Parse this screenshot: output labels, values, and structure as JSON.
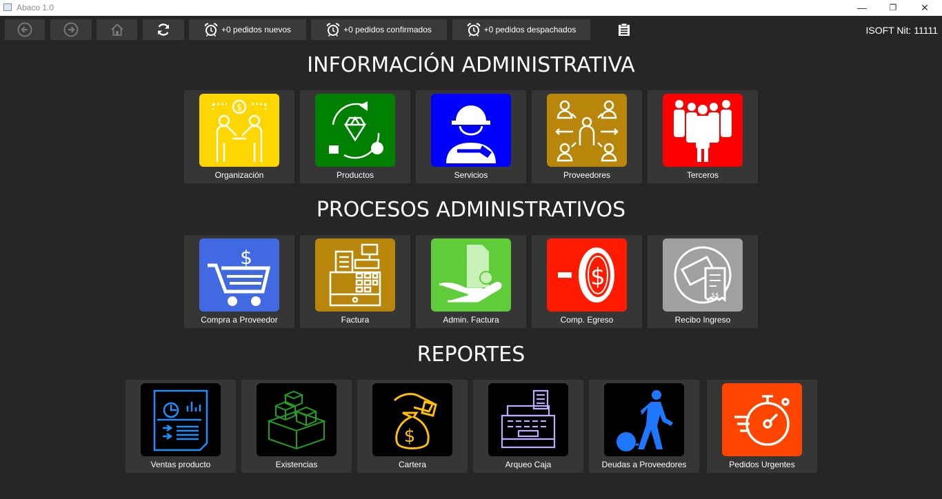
{
  "window": {
    "title": "Abaco 1.0",
    "minimize": "—",
    "restore": "❐",
    "close": "✕"
  },
  "toolbar": {
    "back_icon": "arrow-left-circle-icon",
    "forward_icon": "arrow-right-circle-icon",
    "home_icon": "home-icon",
    "refresh_icon": "refresh-icon",
    "new_orders": "+0 pedidos nuevos",
    "confirmed_orders": "+0 pedidos confirmados",
    "dispatched_orders": "+0 pedidos despachados",
    "clipboard_icon": "clipboard-icon",
    "company": "ISOFT Nit: 11111"
  },
  "sections": {
    "info_title": "INFORMACIÓN ADMINISTRATIVA",
    "process_title": "PROCESOS ADMINISTRATIVOS",
    "reports_title": "REPORTES"
  },
  "info_tiles": [
    {
      "label": "Organización",
      "color": "#ffd700",
      "icon": "handshake-icon"
    },
    {
      "label": "Productos",
      "color": "#008000",
      "icon": "diamond-icon"
    },
    {
      "label": "Servicios",
      "color": "#0000ff",
      "icon": "worker-icon"
    },
    {
      "label": "Proveedores",
      "color": "#b8860b",
      "icon": "network-people-icon"
    },
    {
      "label": "Terceros",
      "color": "#ff0000",
      "icon": "crowd-icon"
    }
  ],
  "process_tiles": [
    {
      "label": "Compra a Proveedor",
      "color": "#4169e1",
      "icon": "shopping-cart-icon"
    },
    {
      "label": "Factura",
      "color": "#b8860b",
      "icon": "cash-register-icon"
    },
    {
      "label": "Admin. Factura",
      "color": "#5fcd3a",
      "icon": "hand-invoice-icon"
    },
    {
      "label": "Comp. Egreso",
      "color": "#ff1a00",
      "icon": "minus-coin-icon"
    },
    {
      "label": "Recibo Ingreso",
      "color": "#a0a0a0",
      "icon": "receipt-icon"
    }
  ],
  "report_tiles": [
    {
      "label": "Ventas producto",
      "color": "#000000",
      "icon": "sales-report-icon"
    },
    {
      "label": "Existencias",
      "color": "#000000",
      "icon": "boxes-icon"
    },
    {
      "label": "Cartera",
      "color": "#000000",
      "icon": "money-bag-icon"
    },
    {
      "label": "Arqueo Caja",
      "color": "#000000",
      "icon": "register-icon"
    },
    {
      "label": "Deudas a Proveedores",
      "color": "#000000",
      "icon": "ball-chain-icon"
    },
    {
      "label": "Pedidos Urgentes",
      "color": "#ff4500",
      "icon": "stopwatch-icon"
    }
  ]
}
